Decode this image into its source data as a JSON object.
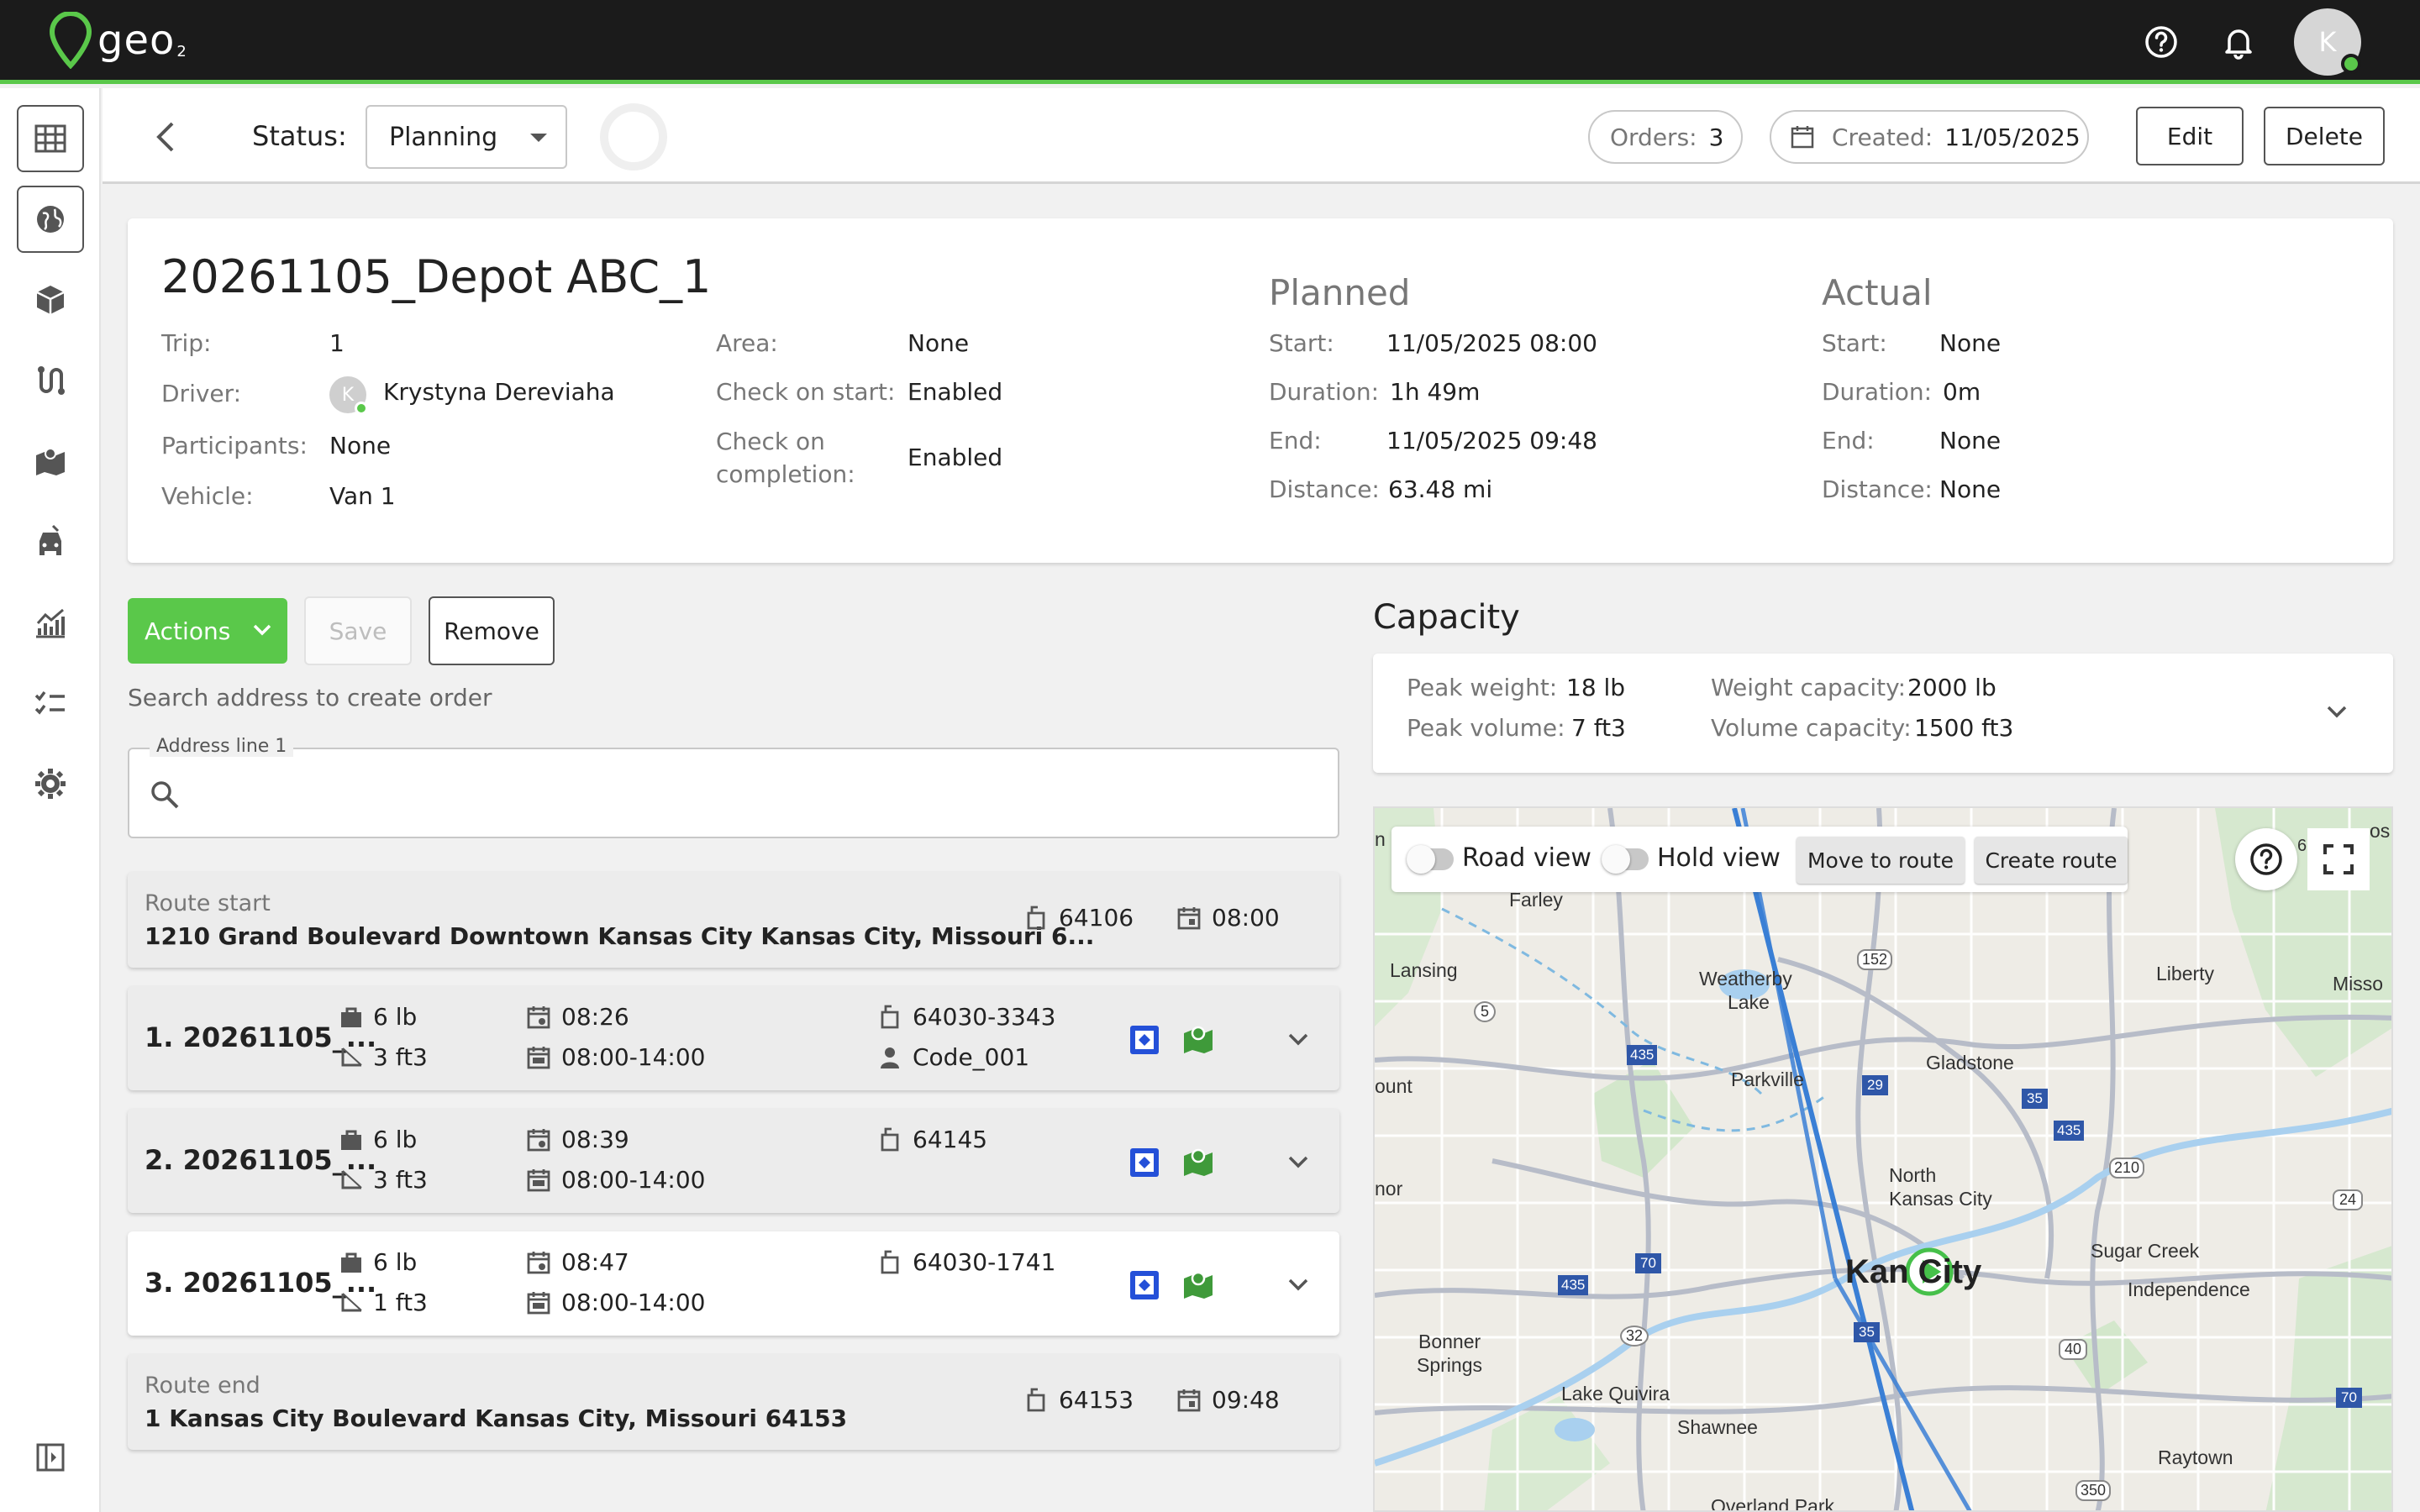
{
  "app": {
    "logo_text": "geo",
    "logo_sub": "2",
    "user_initial": "K",
    "colors": {
      "brand_green": "#5ac84a",
      "topbar": "#1b1b1b",
      "map_route": "#3a7fd5",
      "map_marker": "#46c04a"
    }
  },
  "sidebar": {
    "items": [
      {
        "icon": "building-icon"
      },
      {
        "icon": "globe-icon"
      },
      {
        "icon": "package-icon"
      },
      {
        "icon": "route-icon"
      },
      {
        "icon": "map-icon"
      },
      {
        "icon": "vehicle-icon"
      },
      {
        "icon": "analytics-icon"
      },
      {
        "icon": "checklist-icon"
      },
      {
        "icon": "gear-icon"
      },
      {
        "icon": "collapse-sidebar-icon"
      }
    ]
  },
  "header": {
    "status_label": "Status:",
    "status_value": "Planning",
    "orders_label": "Orders:",
    "orders_value": "3",
    "created_label": "Created:",
    "created_value": "11/05/2025",
    "edit_label": "Edit",
    "delete_label": "Delete"
  },
  "trip": {
    "title": "20261105_Depot ABC_1",
    "trip_label": "Trip:",
    "trip_value": "1",
    "driver_label": "Driver:",
    "driver_initial": "K",
    "driver_value": "Krystyna Dereviaha",
    "participants_label": "Participants:",
    "participants_value": "None",
    "vehicle_label": "Vehicle:",
    "vehicle_value": "Van 1",
    "area_label": "Area:",
    "area_value": "None",
    "check_start_label": "Check on start:",
    "check_start_value": "Enabled",
    "check_completion_label_1": "Check on",
    "check_completion_label_2": "completion:",
    "check_completion_value": "Enabled",
    "planned": {
      "title": "Planned",
      "start_label": "Start:",
      "start_value": "11/05/2025 08:00",
      "duration_label": "Duration:",
      "duration_value": "1h 49m",
      "end_label": "End:",
      "end_value": "11/05/2025 09:48",
      "distance_label": "Distance:",
      "distance_value": "63.48 mi"
    },
    "actual": {
      "title": "Actual",
      "start_label": "Start:",
      "start_value": "None",
      "duration_label": "Duration:",
      "duration_value": "0m",
      "end_label": "End:",
      "end_value": "None",
      "distance_label": "Distance:",
      "distance_value": "None"
    }
  },
  "toolbar": {
    "actions_label": "Actions",
    "save_label": "Save",
    "remove_label": "Remove",
    "search_hint": "Search address to create order",
    "address_legend": "Address line 1",
    "address_value": ""
  },
  "route": {
    "start": {
      "label": "Route start",
      "address": "1210 Grand Boulevard Downtown Kansas City Kansas City, Missouri 6...",
      "zip": "64106",
      "time": "08:00"
    },
    "end": {
      "label": "Route end",
      "address": "1 Kansas City Boulevard Kansas City, Missouri 64153",
      "zip": "64153",
      "time": "09:48"
    },
    "stops": [
      {
        "name": "1. 20261105_...",
        "weight": "6 lb",
        "volume": "3 ft3",
        "eta": "08:26",
        "window": "08:00-14:00",
        "zip": "64030-3343",
        "code": "Code_001"
      },
      {
        "name": "2. 20261105_...",
        "weight": "6 lb",
        "volume": "3 ft3",
        "eta": "08:39",
        "window": "08:00-14:00",
        "zip": "64145",
        "code": ""
      },
      {
        "name": "3. 20261105_...",
        "weight": "6 lb",
        "volume": "1 ft3",
        "eta": "08:47",
        "window": "08:00-14:00",
        "zip": "64030-1741",
        "code": ""
      }
    ]
  },
  "capacity": {
    "title": "Capacity",
    "peak_weight_label": "Peak weight:",
    "peak_weight_value": "18 lb",
    "peak_volume_label": "Peak volume:",
    "peak_volume_value": "7 ft3",
    "weight_capacity_label": "Weight capacity:",
    "weight_capacity_value": "2000 lb",
    "volume_capacity_label": "Volume capacity:",
    "volume_capacity_value": "1500 ft3"
  },
  "map": {
    "road_view_label": "Road view",
    "hold_view_label": "Hold view",
    "move_to_route_label": "Move to route",
    "create_route_label": "Create route",
    "places": {
      "farley": "Farley",
      "lansing": "Lansing",
      "weatherby": "Weatherby",
      "lake": "Lake",
      "liberty": "Liberty",
      "missouri": "Misso",
      "parkville": "Parkville",
      "gladstone": "Gladstone",
      "count": "ount",
      "nor": "nor",
      "north": "North",
      "north_kc": "Kansas City",
      "kansas_city": "Kan   City",
      "sugar_creek": "Sugar Creek",
      "independence": "Independence",
      "bonner": "Bonner",
      "springs": "Springs",
      "lake_quivira": "Lake Quivira",
      "shawnee": "Shawnee",
      "raytown": "Raytown",
      "overland": "Overland Park",
      "edge_top": "n",
      "edge_right": "os",
      "edge_b": "6"
    },
    "shields": {
      "s152": "152",
      "s5": "5",
      "s435a": "435",
      "s29": "29",
      "s35a": "35",
      "s435b": "435",
      "s210": "210",
      "s24": "24",
      "s70a": "70",
      "s435c": "435",
      "s32": "32",
      "s35b": "35",
      "s40": "40",
      "s70b": "70",
      "s350": "350"
    }
  }
}
